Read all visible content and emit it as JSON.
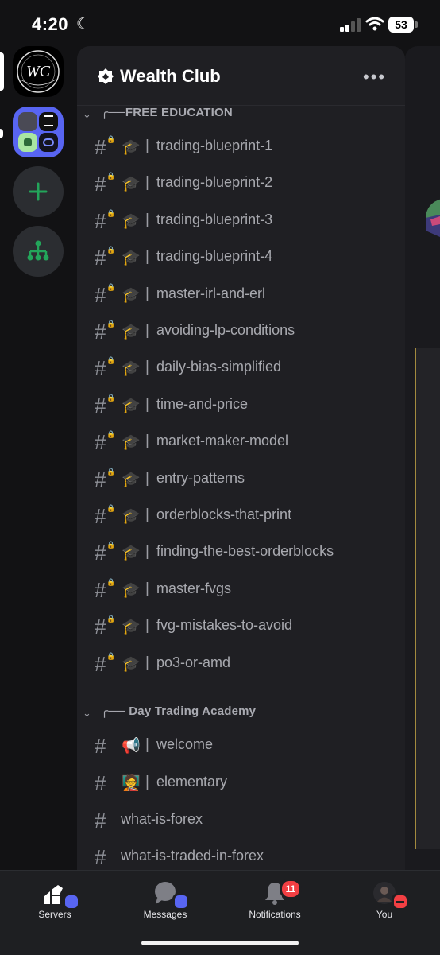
{
  "status": {
    "time": "4:20",
    "battery": "53"
  },
  "server": {
    "name": "Wealth Club",
    "more": "•••"
  },
  "categories": [
    {
      "label": "╭──FREE EDUCATION",
      "channels": [
        {
          "emoji": "🎓",
          "name": "trading-blueprint-1"
        },
        {
          "emoji": "🎓",
          "name": "trading-blueprint-2"
        },
        {
          "emoji": "🎓",
          "name": "trading-blueprint-3"
        },
        {
          "emoji": "🎓",
          "name": "trading-blueprint-4"
        },
        {
          "emoji": "🎓",
          "name": "master-irl-and-erl"
        },
        {
          "emoji": "🎓",
          "name": "avoiding-lp-conditions"
        },
        {
          "emoji": "🎓",
          "name": "daily-bias-simplified"
        },
        {
          "emoji": "🎓",
          "name": "time-and-price"
        },
        {
          "emoji": "🎓",
          "name": "market-maker-model"
        },
        {
          "emoji": "🎓",
          "name": "entry-patterns"
        },
        {
          "emoji": "🎓",
          "name": "orderblocks-that-print"
        },
        {
          "emoji": "🎓",
          "name": "finding-the-best-orderblocks"
        },
        {
          "emoji": "🎓",
          "name": "master-fvgs"
        },
        {
          "emoji": "🎓",
          "name": "fvg-mistakes-to-avoid"
        },
        {
          "emoji": "🎓",
          "name": "po3-or-amd"
        }
      ]
    },
    {
      "label": "╭── Day Trading Academy",
      "channels": [
        {
          "emoji": "📢",
          "name": "welcome"
        },
        {
          "emoji": "🧑‍🏫",
          "name": "elementary"
        },
        {
          "emoji": "",
          "name": "what-is-forex"
        },
        {
          "emoji": "",
          "name": "what-is-traded-in-forex"
        }
      ]
    }
  ],
  "tabs": [
    {
      "label": "Servers",
      "icon": "servers-icon"
    },
    {
      "label": "Messages",
      "icon": "messages-icon"
    },
    {
      "label": "Notifications",
      "icon": "bell-icon",
      "badge": "11"
    },
    {
      "label": "You",
      "icon": "avatar-icon"
    }
  ],
  "colors": {
    "accent": "#5865f2",
    "badge": "#f23f43",
    "add": "#23a55a"
  }
}
